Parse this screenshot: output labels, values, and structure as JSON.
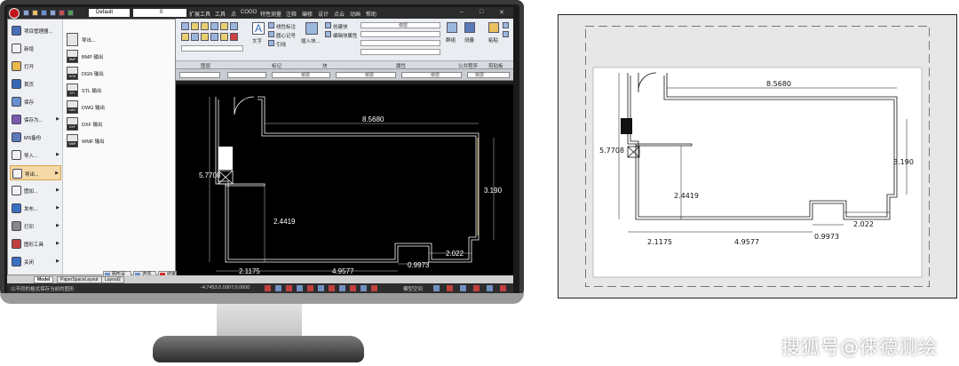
{
  "title_bar": {
    "profile": "Default",
    "layer": "0",
    "menus": [
      "扩展工具",
      "工具",
      "点",
      "COGO",
      "特性测量",
      "注释",
      "编修",
      "设计",
      "点云",
      "动画",
      "帮助"
    ]
  },
  "ribbon": {
    "groups": [
      "图层",
      "标记",
      "块",
      "属性",
      "公共程序",
      "剪贴板"
    ],
    "text_button": "文字",
    "buttons": {
      "dim_linear": "线性标注",
      "dim_radius": "圆心记号",
      "leader": "引线",
      "insert_block": "插入块...",
      "create_block": "创建块",
      "block_attr": "编辑块属性",
      "layer_name": "依层",
      "measure": "测量",
      "paste": "粘贴",
      "group": "群组"
    },
    "property_combos": [
      "依层",
      "依层",
      "依层",
      "依层"
    ]
  },
  "app_menu": {
    "items": [
      {
        "label": "项目管理器...",
        "icon": "project-manager-icon",
        "arrow": false,
        "color": "#4a6fb5"
      },
      {
        "label": "新增",
        "icon": "new-document-icon",
        "arrow": false,
        "color": "#f2f2f2"
      },
      {
        "label": "打开",
        "icon": "open-folder-icon",
        "arrow": false,
        "color": "#e8b84a"
      },
      {
        "label": "首页",
        "icon": "power-icon",
        "arrow": false,
        "color": "#3567b5"
      },
      {
        "label": "保存",
        "icon": "save-icon",
        "arrow": false,
        "color": "#6a8fd0"
      },
      {
        "label": "保存为...",
        "icon": "save-as-icon",
        "arrow": true,
        "color": "#7a5ab0"
      },
      {
        "label": "MS备份",
        "icon": "backup-icon",
        "arrow": false,
        "color": "#5a7ab8"
      },
      {
        "label": "导入...",
        "icon": "import-icon",
        "arrow": true,
        "color": "#f2f2f2"
      },
      {
        "label": "导出...",
        "icon": "export-icon",
        "arrow": true,
        "color": "#f2f2f2",
        "active": true
      },
      {
        "label": "图加...",
        "icon": "attach-icon",
        "arrow": true,
        "color": "#f2f2f2"
      },
      {
        "label": "发布...",
        "icon": "publish-icon",
        "arrow": true,
        "color": "#3b6fc0"
      },
      {
        "label": "打印",
        "icon": "print-icon",
        "arrow": true,
        "color": "#888888"
      },
      {
        "label": "图形工具",
        "icon": "drawing-tools-icon",
        "arrow": true,
        "color": "#c04040"
      },
      {
        "label": "关闭",
        "icon": "close-icon",
        "arrow": true,
        "color": "#3b6fc0"
      }
    ],
    "submenu": [
      {
        "label": "导出...",
        "badge": ""
      },
      {
        "label": "BMP 输出",
        "badge": "BMP"
      },
      {
        "label": "DGN 输出",
        "badge": "DGN"
      },
      {
        "label": "STL 输出",
        "badge": "STL"
      },
      {
        "label": "DWG 输出",
        "badge": "DWG"
      },
      {
        "label": "DXF 输出",
        "badge": "DXF"
      },
      {
        "label": "WMF 输出",
        "badge": "WMF"
      }
    ],
    "footer": [
      "图形设置...",
      "选项...",
      "结束(X)"
    ]
  },
  "tabs": [
    "Model",
    "PaperSpaceLayout",
    "Layout2"
  ],
  "status": {
    "hint": "以不同的格式保存当前的图形",
    "coords": "-4.7453,0.0907,0.0000",
    "space": "模型空间"
  },
  "dimensions": {
    "top_width": "8.5680",
    "left_height": "5.7708",
    "right_height": "3.190",
    "inner_height": "2.4419",
    "bottom_a": "2.1175",
    "bottom_b": "4.9577",
    "bottom_c": "0.9973",
    "bottom_d": "2.022"
  },
  "watermark": "搜狐号@徕德测绘",
  "colors": {
    "accent_red": "#c0151b",
    "canvas_black": "#000000",
    "panel_gray": "#e7e7e7",
    "menu_highlight": "#f4d9a6"
  }
}
